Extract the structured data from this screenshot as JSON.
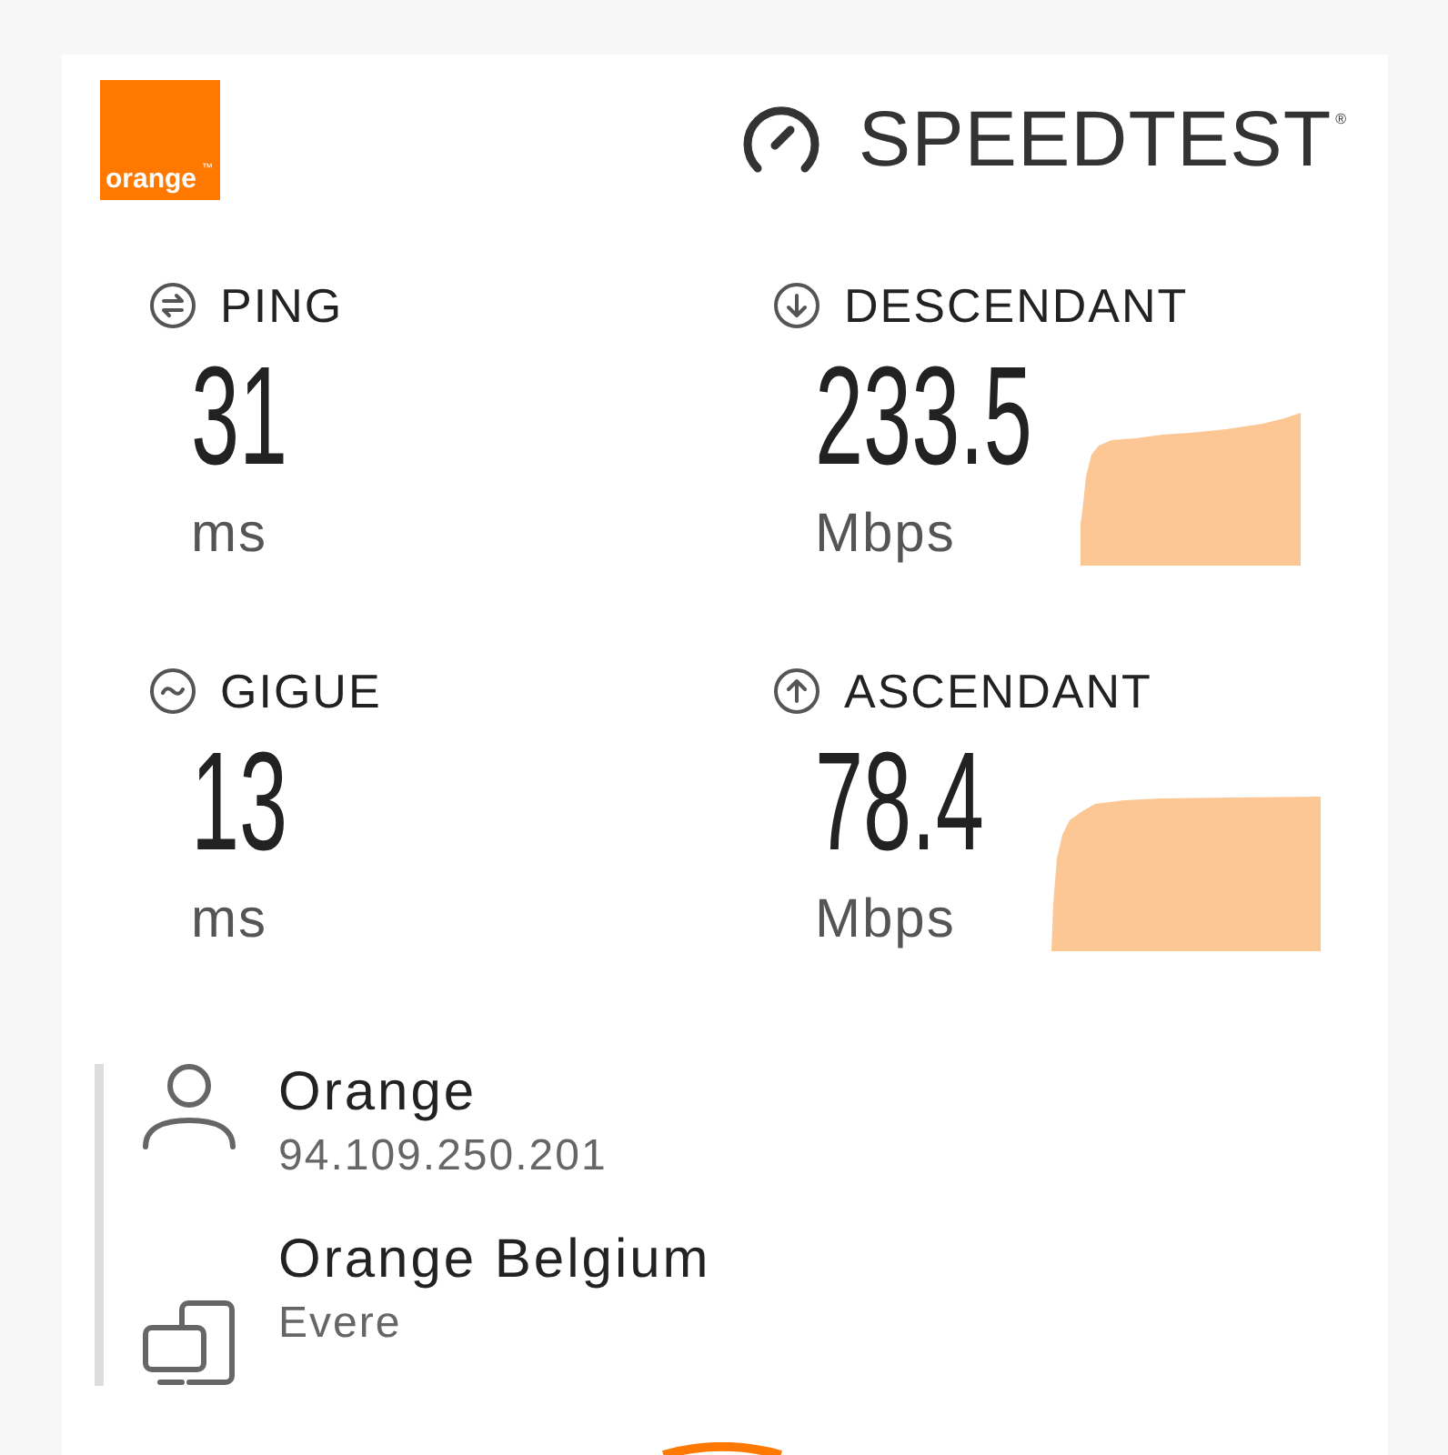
{
  "header": {
    "operator_logo": {
      "text": "orange",
      "trademark": "™"
    },
    "brand": {
      "text": "SPEEDTEST",
      "registered": "®"
    }
  },
  "metrics": [
    {
      "kind": "ping",
      "label": "PING",
      "value": "31",
      "unit": "ms"
    },
    {
      "kind": "download",
      "label": "DESCENDANT",
      "value": "233.5",
      "unit": "Mbps"
    },
    {
      "kind": "jitter",
      "label": "GIGUE",
      "value": "13",
      "unit": "ms"
    },
    {
      "kind": "upload",
      "label": "ASCENDANT",
      "value": "78.4",
      "unit": "Mbps"
    }
  ],
  "connection": [
    {
      "kind": "provider",
      "name": "Orange",
      "detail": "94.109.250.201"
    },
    {
      "kind": "server",
      "name": "Orange Belgium",
      "detail": "Evere"
    }
  ]
}
